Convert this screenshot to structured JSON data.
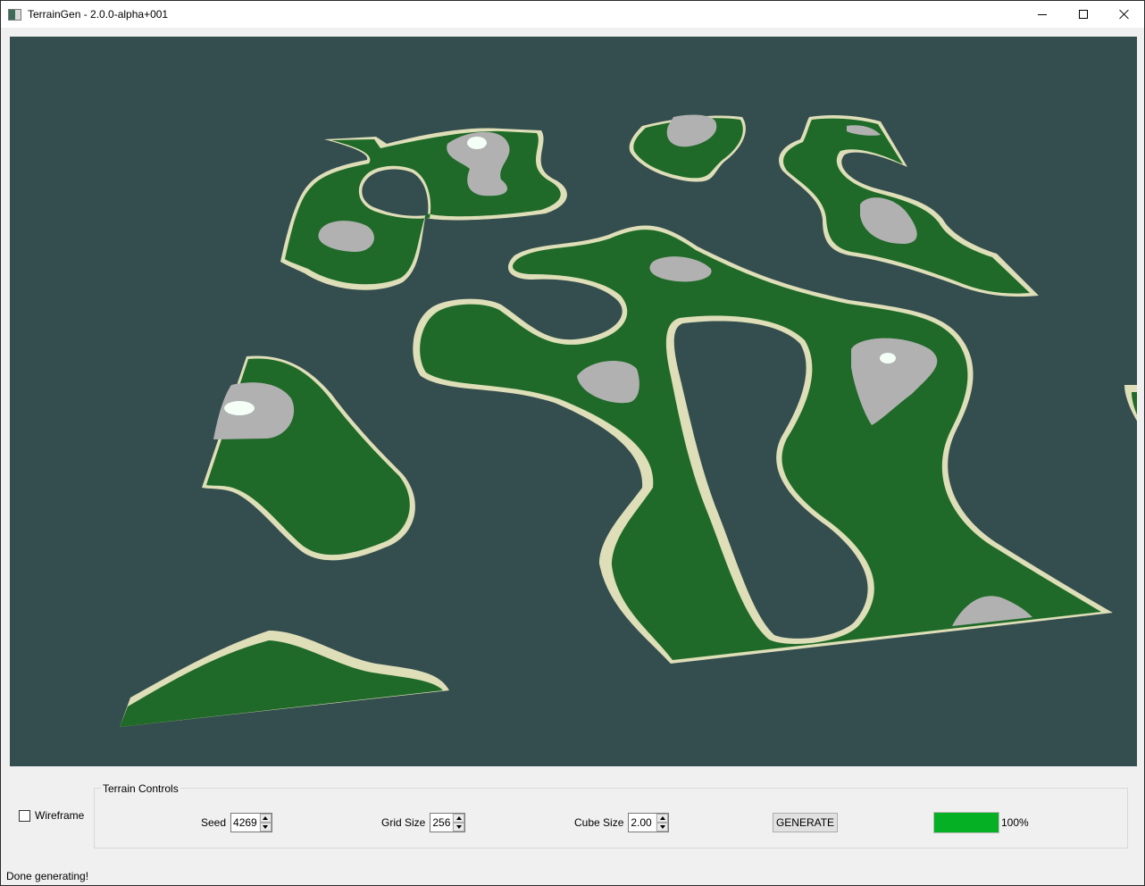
{
  "window": {
    "title": "TerrainGen - 2.0.0-alpha+001",
    "app_icon": "terrain-app-icon",
    "controls": [
      "minimize",
      "maximize",
      "close"
    ]
  },
  "viewport": {
    "description": "3D terrain render (perspective)",
    "colors": {
      "water": "#344d4e",
      "sand": "#dedeb8",
      "grass": "#1f6a28",
      "rock": "#b1b1b1",
      "snow": "#f4fff7"
    }
  },
  "options": {
    "wireframe_label": "Wireframe",
    "wireframe_checked": false
  },
  "terrain_controls": {
    "title": "Terrain Controls",
    "seed": {
      "label": "Seed",
      "value": "4269"
    },
    "grid_size": {
      "label": "Grid Size",
      "value": "256"
    },
    "cube_size": {
      "label": "Cube Size",
      "value": "2.00"
    },
    "generate_label": "GENERATE",
    "progress": {
      "percent": 100,
      "text": "100%",
      "color": "#06b025"
    }
  },
  "status_bar": {
    "message": "Done generating!"
  }
}
